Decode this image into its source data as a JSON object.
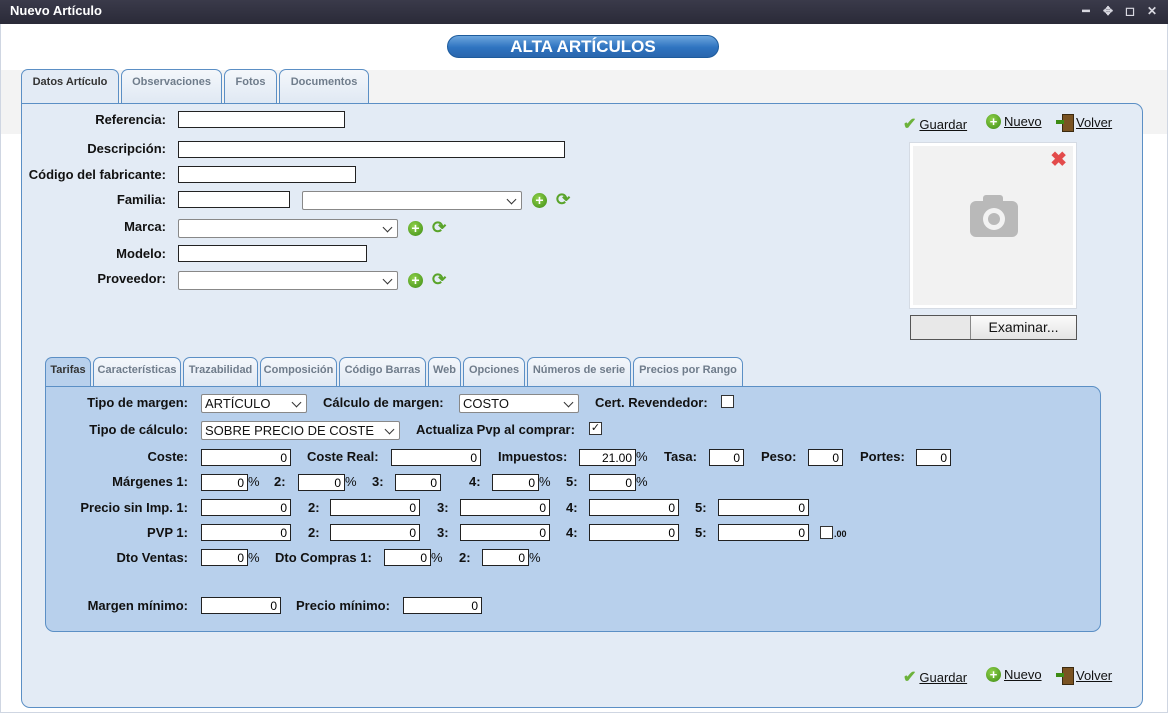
{
  "window": {
    "title": "Nuevo Artículo",
    "controls": [
      "minimize-icon",
      "move-icon",
      "maximize-icon",
      "close-icon"
    ]
  },
  "page_title": "ALTA ARTÍCULOS",
  "main_tabs": [
    {
      "label": "Datos Artículo",
      "active": true
    },
    {
      "label": "Observaciones"
    },
    {
      "label": "Fotos"
    },
    {
      "label": "Documentos"
    }
  ],
  "actions": {
    "save": "Guardar",
    "new": "Nuevo",
    "back": "Volver"
  },
  "form": {
    "referencia_label": "Referencia:",
    "descripcion_label": "Descripción:",
    "codigo_fabricante_label": "Código del fabricante:",
    "familia_label": "Familia:",
    "marca_label": "Marca:",
    "modelo_label": "Modelo:",
    "proveedor_label": "Proveedor:",
    "referencia_value": "",
    "descripcion_value": "",
    "codigo_fabricante_value": "",
    "familia_code_value": "",
    "familia_select": "",
    "marca_select": "",
    "modelo_value": "",
    "proveedor_select": ""
  },
  "photo": {
    "browse_button": "Examinar..."
  },
  "sub_tabs": [
    {
      "label": "Tarifas",
      "active": true
    },
    {
      "label": "Características"
    },
    {
      "label": "Trazabilidad"
    },
    {
      "label": "Composición"
    },
    {
      "label": "Código Barras"
    },
    {
      "label": "Web"
    },
    {
      "label": "Opciones"
    },
    {
      "label": "Números de serie"
    },
    {
      "label": "Precios por Rango"
    }
  ],
  "tarifas": {
    "tipo_margen_label": "Tipo de margen:",
    "tipo_margen_value": "ARTÍCULO",
    "calculo_margen_label": "Cálculo de margen:",
    "calculo_margen_value": "COSTO",
    "cert_revendedor_label": "Cert. Revendedor:",
    "cert_revendedor_checked": false,
    "tipo_calculo_label": "Tipo de cálculo:",
    "tipo_calculo_value": "SOBRE PRECIO DE COSTE",
    "actualiza_pvp_label": "Actualiza Pvp al comprar:",
    "actualiza_pvp_checked": "✓",
    "coste_label": "Coste:",
    "coste_value": "0",
    "coste_real_label": "Coste Real:",
    "coste_real_value": "0",
    "impuestos_label": "Impuestos:",
    "impuestos_value": "21.00",
    "tasa_label": "Tasa:",
    "tasa_value": "0",
    "peso_label": "Peso:",
    "peso_value": "0",
    "portes_label": "Portes:",
    "portes_value": "0",
    "margenes_label": "Márgenes 1:",
    "margenes": [
      "0",
      "0",
      "0",
      "0",
      "0"
    ],
    "precio_sin_imp_label": "Precio sin Imp. 1:",
    "precio_sin_imp": [
      "0",
      "0",
      "0",
      "0",
      "0"
    ],
    "pvp_label": "PVP 1:",
    "pvp": [
      "0",
      "0",
      "0",
      "0",
      "0"
    ],
    "idx2": "2:",
    "idx3": "3:",
    "idx4": "4:",
    "idx5": "5:",
    "percent": "%",
    "round_suffix": ".00",
    "dto_ventas_label": "Dto Ventas:",
    "dto_ventas_value": "0",
    "dto_compras_label": "Dto Compras 1:",
    "dto_compras_1_value": "0",
    "dto_compras_2_value": "0",
    "margen_minimo_label": "Margen mínimo:",
    "margen_minimo_value": "0",
    "precio_minimo_label": "Precio mínimo:",
    "precio_minimo_value": "0"
  }
}
